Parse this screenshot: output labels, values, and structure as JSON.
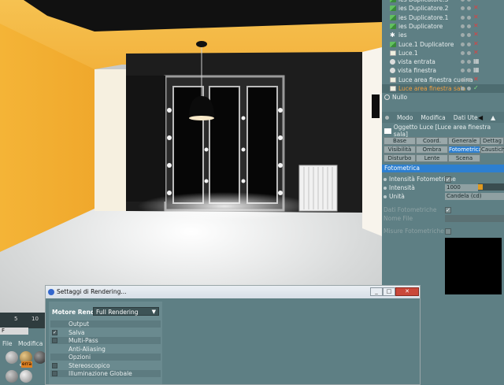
{
  "object_manager": {
    "items": [
      {
        "label": "ies Duplicatore.3",
        "icon": "cloner-icon",
        "tag": "x"
      },
      {
        "label": "ies Duplicatore.2",
        "icon": "cloner-icon",
        "tag": "x"
      },
      {
        "label": "ies Duplicatore.1",
        "icon": "cloner-icon",
        "tag": "x"
      },
      {
        "label": "ies Duplicatore",
        "icon": "cloner-icon",
        "tag": "x"
      },
      {
        "label": "ies",
        "icon": "star-icon",
        "tag": "x"
      },
      {
        "label": "Luce.1 Duplicatore",
        "icon": "cloner-icon",
        "tag": "x"
      },
      {
        "label": "Luce.1",
        "icon": "light-icon",
        "tag": "x"
      },
      {
        "label": "vista entrata",
        "icon": "camera-icon",
        "tag": "grid"
      },
      {
        "label": "vista finestra",
        "icon": "camera-icon",
        "tag": "grid"
      },
      {
        "label": "Luce area finestra cucina",
        "icon": "light-icon",
        "tag": "x"
      },
      {
        "label": "Luce area finestra sala",
        "icon": "light-icon",
        "tag": "check"
      },
      {
        "label": "Nullo",
        "icon": "null-icon",
        "tag": ""
      }
    ]
  },
  "attribute_manager": {
    "menu": [
      "Modo",
      "Modifica",
      "Dati Ute"
    ],
    "object_title": "Oggetto Luce [Luce area finestra sala]",
    "tabs": [
      [
        "Base",
        "Coord.",
        "Generale",
        "Dettag"
      ],
      [
        "Visibilità",
        "Ombra",
        "Fotometrica",
        "Caustich"
      ],
      [
        "Disturbo",
        "Lente",
        "Scena"
      ]
    ],
    "active_tab": "Fotometrica",
    "section": "Fotometrica",
    "props": {
      "intensita_fotometriche": "Intensità Fotometriche",
      "intensita": "Intensità",
      "intensita_value": "1000",
      "unita": "Unità",
      "unita_value": "Candela (cd)",
      "dati_fotometriche": "Dati Fotometriche",
      "nome_file": "Nome File",
      "misure_fotometriche": "Misure Fotometriche"
    }
  },
  "material_manager": {
    "ruler": [
      "5",
      "10"
    ],
    "frame": "F",
    "menu": [
      "File",
      "Modifica"
    ],
    "materials": [
      "",
      "egno",
      "erra",
      ""
    ]
  },
  "render_dialog": {
    "title": "Settaggi di Rendering...",
    "engine_label": "Motore Render",
    "engine_value": "Full Rendering",
    "items": [
      {
        "label": "Output",
        "checked": null
      },
      {
        "label": "Salva",
        "checked": true
      },
      {
        "label": "Multi-Pass",
        "checked": false
      },
      {
        "label": "Anti-Aliasing",
        "checked": null
      },
      {
        "label": "Opzioni",
        "checked": null
      },
      {
        "label": "Stereoscopico",
        "checked": false
      },
      {
        "label": "Illuminazione Globale",
        "checked": false
      }
    ]
  },
  "colors": {
    "panel_bg": "#5e7f84",
    "accent_blue": "#2d7fd0",
    "selected_text": "#f0a040",
    "wall_orange": "#f2b43a"
  }
}
